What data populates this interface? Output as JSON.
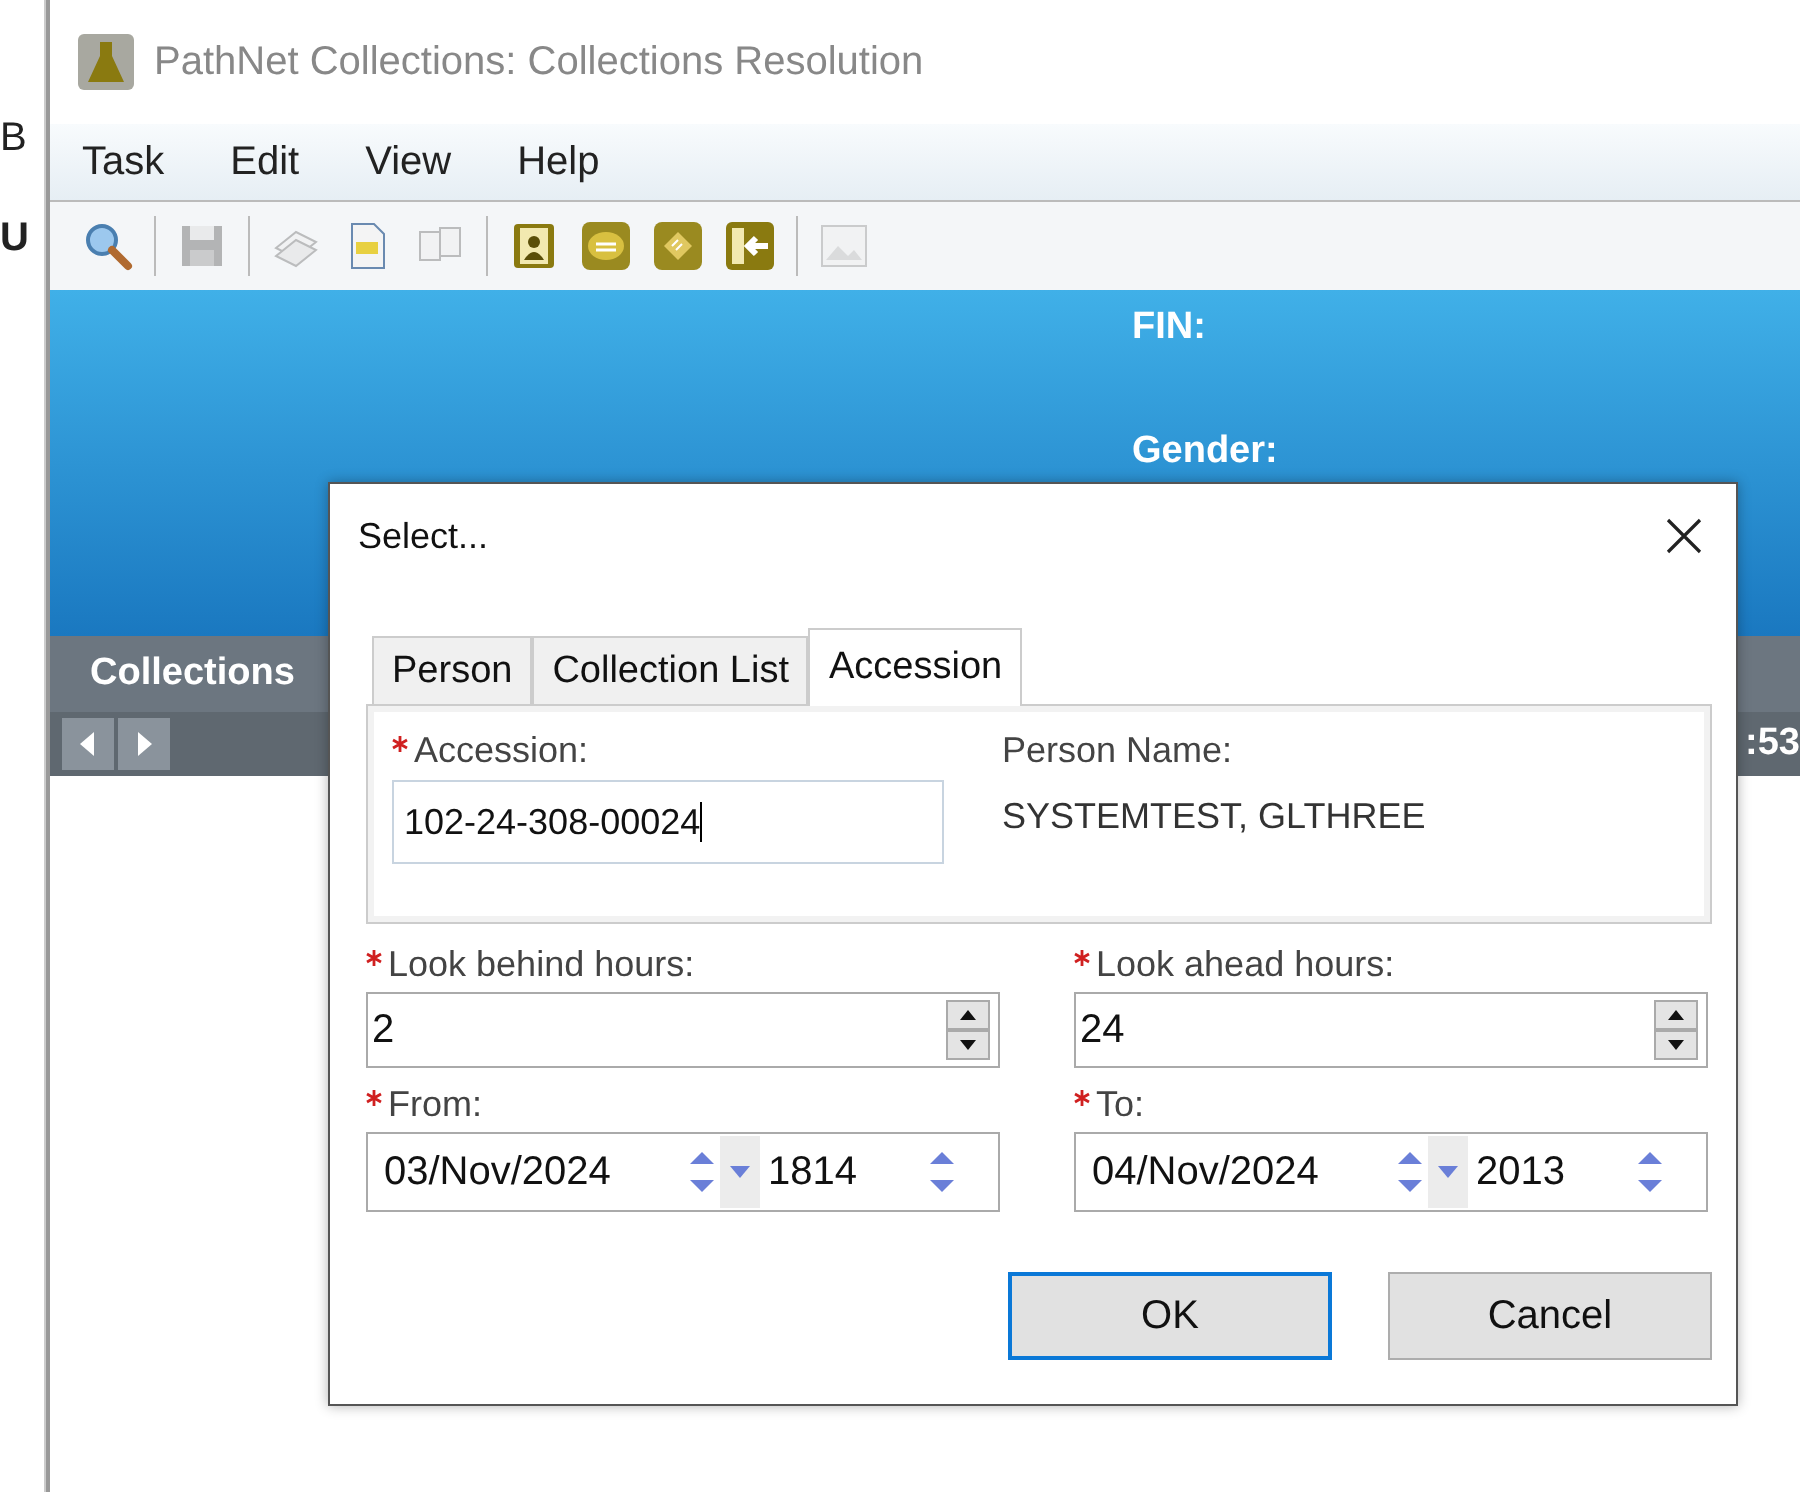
{
  "background_window": {
    "fragments": [
      "B",
      "U"
    ]
  },
  "window": {
    "title": "PathNet Collections: Collections Resolution"
  },
  "menu": [
    "Task",
    "Edit",
    "View",
    "Help"
  ],
  "toolbar": [
    {
      "kind": "search",
      "disabled": false
    },
    {
      "kind": "separator"
    },
    {
      "kind": "save",
      "disabled": true
    },
    {
      "kind": "separator"
    },
    {
      "kind": "labels",
      "disabled": true
    },
    {
      "kind": "document",
      "disabled": false
    },
    {
      "kind": "pages",
      "disabled": true
    },
    {
      "kind": "separator"
    },
    {
      "kind": "person",
      "disabled": false
    },
    {
      "kind": "comment",
      "disabled": false
    },
    {
      "kind": "tag",
      "disabled": false
    },
    {
      "kind": "exit",
      "disabled": false
    },
    {
      "kind": "separator"
    },
    {
      "kind": "image",
      "disabled": true
    }
  ],
  "banner": {
    "labels": [
      "FIN:",
      "Gender:"
    ]
  },
  "section": {
    "title": "Collections",
    "time_fragment": ":53"
  },
  "dialog": {
    "title": "Select...",
    "tabs": [
      {
        "label": "Person",
        "selected": false
      },
      {
        "label": "Collection List",
        "selected": false
      },
      {
        "label": "Accession",
        "selected": true
      }
    ],
    "accession": {
      "label": "Accession:",
      "required": true,
      "value": "102-24-308-00024"
    },
    "person_name": {
      "label": "Person Name:",
      "value": "SYSTEMTEST, GLTHREE"
    },
    "look_behind": {
      "label": "Look behind hours:",
      "required": true,
      "value": "2"
    },
    "look_ahead": {
      "label": "Look ahead hours:",
      "required": true,
      "value": "24"
    },
    "from": {
      "label": "From:",
      "required": true,
      "date": "03/Nov/2024",
      "time": "1814"
    },
    "to": {
      "label": "To:",
      "required": true,
      "date": "04/Nov/2024",
      "time": "2013"
    },
    "buttons": [
      {
        "label": "OK",
        "default": true
      },
      {
        "label": "Cancel",
        "default": false
      }
    ]
  }
}
